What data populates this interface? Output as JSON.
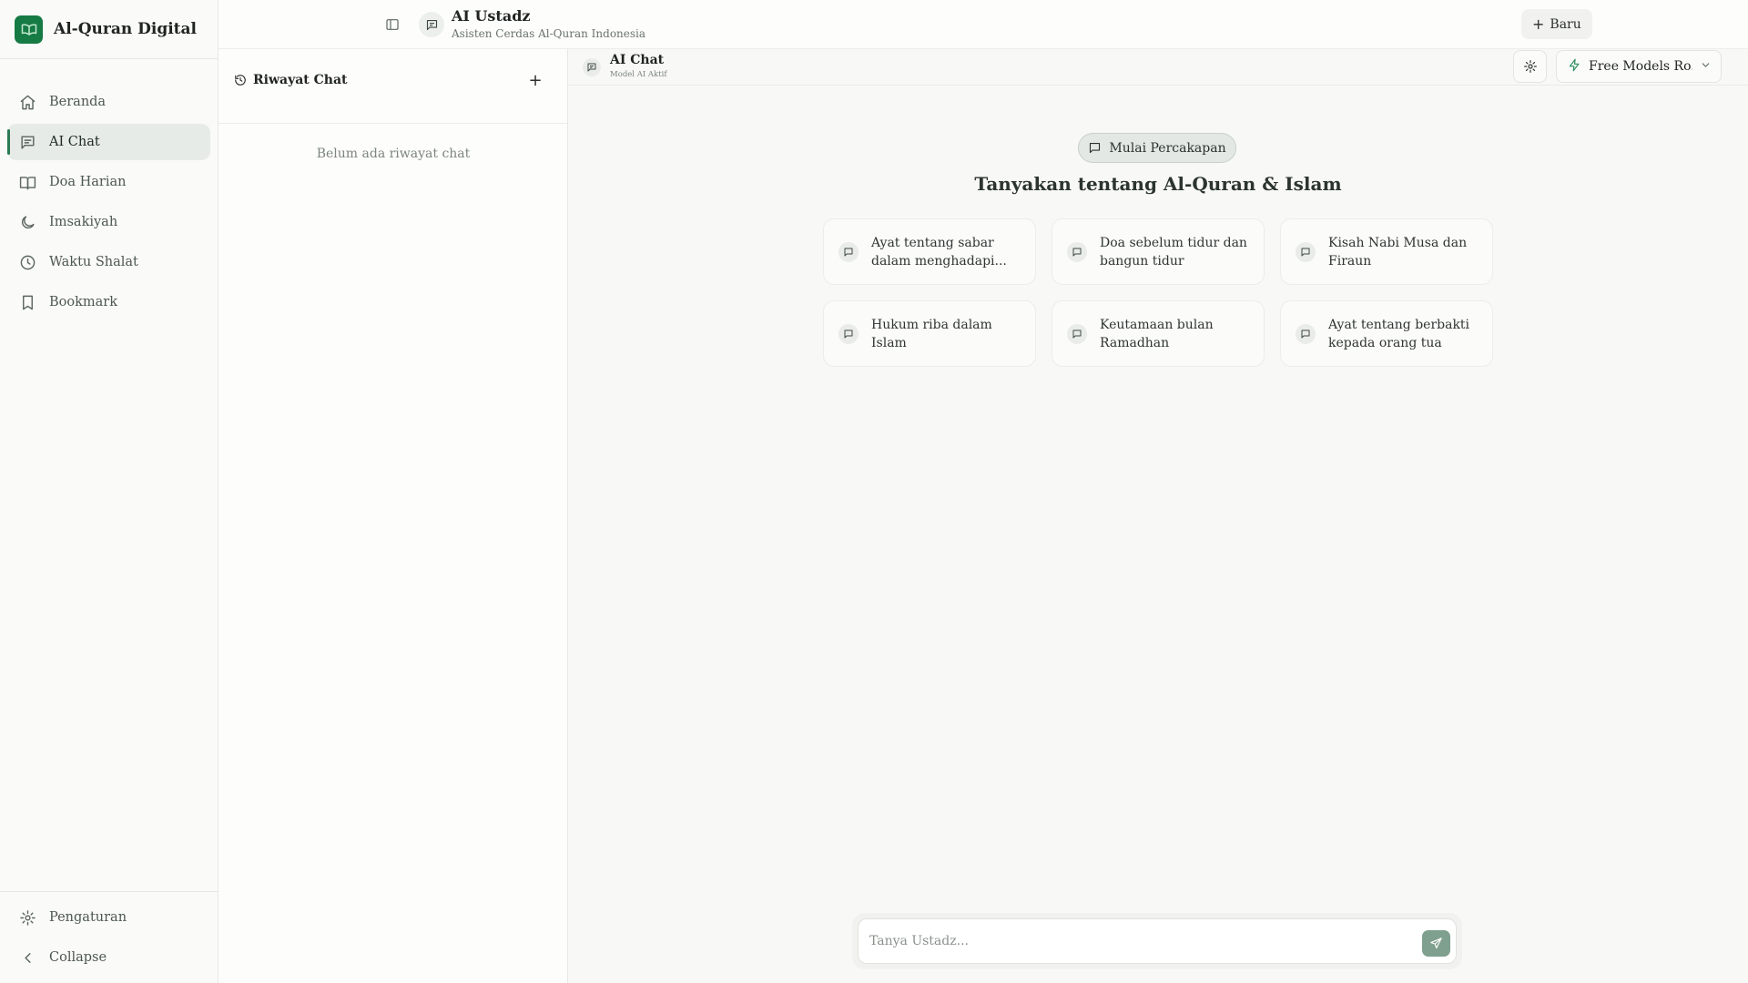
{
  "brand": {
    "name": "Al-Quran Digital",
    "logo_color": "#167a44"
  },
  "sidebar": {
    "items": [
      {
        "label": "Beranda",
        "icon": "home-icon",
        "active": false
      },
      {
        "label": "AI Chat",
        "icon": "chat-icon",
        "active": true
      },
      {
        "label": "Doa Harian",
        "icon": "book-open-icon",
        "active": false
      },
      {
        "label": "Imsakiyah",
        "icon": "moon-icon",
        "active": false
      },
      {
        "label": "Waktu Shalat",
        "icon": "clock-icon",
        "active": false
      },
      {
        "label": "Bookmark",
        "icon": "bookmark-icon",
        "active": false
      }
    ],
    "bottom": {
      "settings_label": "Pengaturan",
      "collapse_label": "Collapse"
    }
  },
  "header": {
    "title": "AI Ustadz",
    "subtitle": "Asisten Cerdas Al-Quran Indonesia",
    "new_button_label": "Baru"
  },
  "history": {
    "title": "Riwayat Chat",
    "empty_text": "Belum ada riwayat chat"
  },
  "chat": {
    "title": "AI Chat",
    "subtitle": "Model AI Aktif",
    "model_selected": "Free Models Ro...",
    "start_label": "Mulai Percakapan",
    "heading": "Tanyakan tentang Al-Quran & Islam",
    "suggestions": [
      "Ayat tentang sabar dalam menghadapi...",
      "Doa sebelum tidur dan bangun tidur",
      "Kisah Nabi Musa dan Firaun",
      "Hukum riba dalam Islam",
      "Keutamaan bulan Ramadhan",
      "Ayat tentang berbakti kepada orang tua"
    ],
    "input_placeholder": "Tanya Ustadz...",
    "input_value": ""
  },
  "colors": {
    "accent": "#2b7a54",
    "send_button": "#7fa08e",
    "model_bolt": "#2a8d5c"
  }
}
